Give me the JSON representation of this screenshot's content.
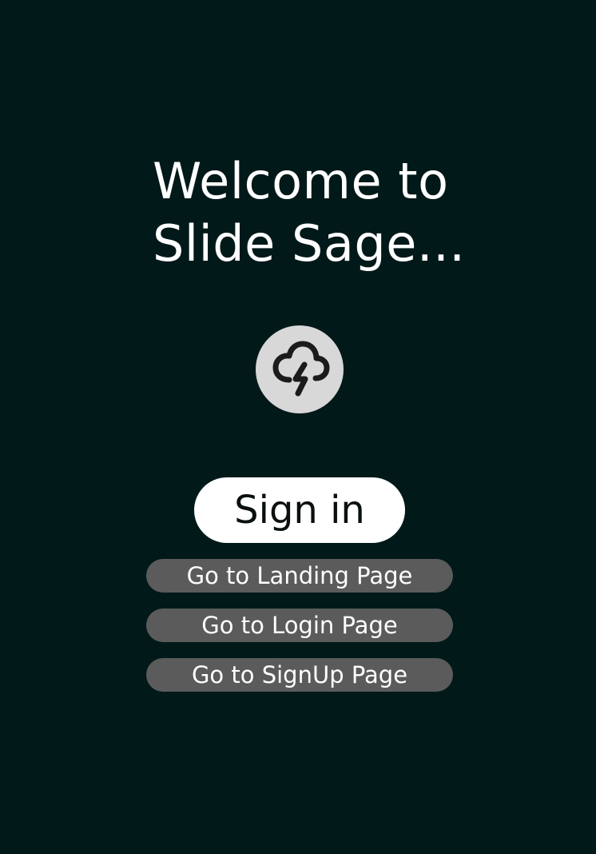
{
  "welcome": {
    "line1": "Welcome to",
    "line2": "Slide Sage..."
  },
  "logo": {
    "icon": "cloud-lightning-icon"
  },
  "buttons": {
    "sign_in": "Sign in",
    "landing": "Go to Landing Page",
    "login": "Go to Login Page",
    "signup": "Go to SignUp Page"
  },
  "colors": {
    "background": "#02191a",
    "primary_button": "#ffffff",
    "secondary_button": "#5b5b5b",
    "logo_circle": "#d8d8d8"
  }
}
